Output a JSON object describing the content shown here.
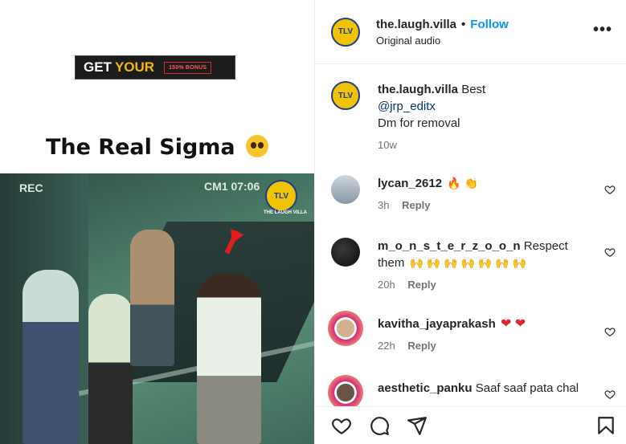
{
  "media": {
    "banner": {
      "get": "GET",
      "your": "YOUR",
      "bonus": "150% BONUS"
    },
    "title": "The Real Sigma",
    "video": {
      "rec": "REC",
      "cam": "CM1 07:06",
      "badge": "TLV",
      "badge_sub": "THE LAUGH VILLA"
    }
  },
  "header": {
    "avatar_text": "TLV",
    "username": "the.laugh.villa",
    "separator": "•",
    "follow_label": "Follow",
    "audio": "Original audio",
    "more": "•••"
  },
  "caption": {
    "avatar_text": "TLV",
    "username": "the.laugh.villa",
    "text1": "Best",
    "mention": "@jrp_editx",
    "text2": "Dm for removal",
    "time": "10w"
  },
  "comments": [
    {
      "username": "lycan_2612",
      "text": "",
      "emoji": "🔥 👏",
      "time": "3h",
      "reply": "Reply"
    },
    {
      "username": "m_o_n_s_t_e_r_z_o_o_n",
      "text": "Respect them",
      "emoji": "🙌 🙌 🙌 🙌 🙌 🙌 🙌",
      "time": "20h",
      "reply": "Reply"
    },
    {
      "username": "kavitha_jayaprakash",
      "text": "",
      "emoji": "❤ ❤",
      "time": "22h",
      "reply": "Reply"
    },
    {
      "username": "aesthetic_panku",
      "text": "Saaf saaf pata chal",
      "emoji": "",
      "time": "",
      "reply": ""
    }
  ],
  "colors": {
    "accent": "#0095f6",
    "brand_yellow": "#f0c400",
    "brand_blue": "#1c3f8a",
    "arrow_red": "#e21c1c"
  },
  "icons": [
    "like-icon",
    "comment-icon",
    "share-icon",
    "save-icon",
    "more-icon",
    "small-heart-icon"
  ]
}
